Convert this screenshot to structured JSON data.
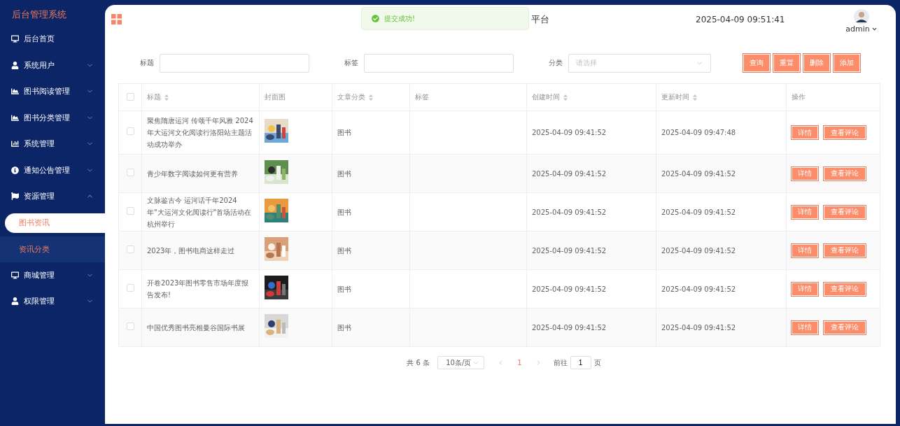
{
  "sidebar": {
    "title": "后台管理系统",
    "items": [
      {
        "label": "后台首页",
        "has_children": false,
        "expanded": false
      },
      {
        "label": "系统用户",
        "has_children": true,
        "expanded": false
      },
      {
        "label": "图书阅读管理",
        "has_children": true,
        "expanded": false
      },
      {
        "label": "图书分类管理",
        "has_children": true,
        "expanded": false
      },
      {
        "label": "系统管理",
        "has_children": true,
        "expanded": false
      },
      {
        "label": "通知公告管理",
        "has_children": true,
        "expanded": false
      },
      {
        "label": "资源管理",
        "has_children": true,
        "expanded": true,
        "children": [
          {
            "label": "图书资讯",
            "selected": true,
            "hovered": false
          },
          {
            "label": "资讯分类",
            "selected": false,
            "hovered": true
          }
        ]
      },
      {
        "label": "商城管理",
        "has_children": true,
        "expanded": false
      },
      {
        "label": "权限管理",
        "has_children": true,
        "expanded": false
      }
    ]
  },
  "header": {
    "title": "平台",
    "datetime": "2025-04-09 09:51:41",
    "user": "admin"
  },
  "toast": {
    "kind": "success",
    "message": "提交成功!"
  },
  "filters": [
    {
      "kind": "input",
      "label": "标题"
    },
    {
      "kind": "input",
      "label": "标签"
    },
    {
      "kind": "select",
      "label": "分类",
      "placeholder": "请选择"
    }
  ],
  "buttons": [
    "查询",
    "重置",
    "删除",
    "添加"
  ],
  "table": {
    "all_checked": false,
    "columns": [
      {
        "label": "标题",
        "sortable": true
      },
      {
        "label": "封面图",
        "sortable": false
      },
      {
        "label": "文章分类",
        "sortable": true
      },
      {
        "label": "标签",
        "sortable": false
      },
      {
        "label": "创建时间",
        "sortable": true
      },
      {
        "label": "更新时间",
        "sortable": true
      },
      {
        "label": "操作",
        "sortable": false
      }
    ],
    "rows": [
      {
        "checked": false,
        "title": "聚焦隋唐运河 传颂千年风雅 2024年大运河文化阅读行洛阳站主题活动成功举办",
        "cover": {
          "kind": "picture"
        },
        "category": "图书",
        "created": "2025-04-09 09:41:52",
        "updated": "2025-04-09 09:47:48",
        "actions": [
          "详情",
          "查看评论"
        ]
      },
      {
        "checked": false,
        "title": "青少年数字阅读如何更有营养",
        "cover": {
          "kind": "picture"
        },
        "category": "图书",
        "created": "2025-04-09 09:41:52",
        "updated": "2025-04-09 09:41:52",
        "actions": [
          "详情",
          "查看评论"
        ]
      },
      {
        "checked": false,
        "title": "文脉鉴古今 运河话千年2024年\"大运河文化阅读行\"首场活动在杭州举行",
        "cover": {
          "kind": "picture"
        },
        "category": "图书",
        "created": "2025-04-09 09:41:52",
        "updated": "2025-04-09 09:41:52",
        "actions": [
          "详情",
          "查看评论"
        ]
      },
      {
        "checked": false,
        "title": "2023年，图书电商这样走过",
        "cover": {
          "kind": "picture"
        },
        "category": "图书",
        "created": "2025-04-09 09:41:52",
        "updated": "2025-04-09 09:41:52",
        "actions": [
          "详情",
          "查看评论"
        ]
      },
      {
        "checked": false,
        "title": "开卷2023年图书零售市场年度报告发布!",
        "cover": {
          "kind": "picture"
        },
        "category": "图书",
        "created": "2025-04-09 09:41:52",
        "updated": "2025-04-09 09:41:52",
        "actions": [
          "详情",
          "查看评论"
        ]
      },
      {
        "checked": false,
        "title": "中国优秀图书亮相曼谷国际书展",
        "cover": {
          "kind": "picture"
        },
        "category": "图书",
        "created": "2025-04-09 09:41:52",
        "updated": "2025-04-09 09:41:52",
        "actions": [
          "详情",
          "查看评论"
        ]
      }
    ]
  },
  "pagination": {
    "total": "共 6 条",
    "page_size": "10条/页",
    "pages": [
      {
        "label": "1",
        "selected": true
      }
    ],
    "goto_label": "前往",
    "goto_value": "1",
    "goto_suffix": "页"
  }
}
